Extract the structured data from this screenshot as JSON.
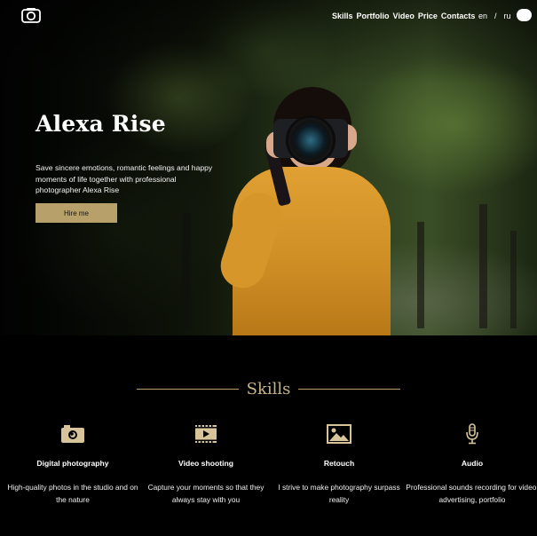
{
  "header": {
    "logo_icon": "camera-icon",
    "nav": [
      "Skills",
      "Portfolio",
      "Video",
      "Price",
      "Contacts"
    ],
    "lang": [
      "en",
      "/",
      "ru"
    ],
    "theme_toggle": "toggle"
  },
  "hero": {
    "title": "Alexa Rise",
    "description": "Save sincere emotions, romantic feelings and happy moments of life together with professional photographer Alexa Rise",
    "button": "Hire me"
  },
  "skills": {
    "title": "Skills",
    "items": [
      {
        "icon": "camera-icon",
        "name": "Digital photography",
        "text": "High-quality photos in the studio and on the nature"
      },
      {
        "icon": "film-icon",
        "name": "Video shooting",
        "text": "Capture your moments so that they always stay with you"
      },
      {
        "icon": "image-icon",
        "name": "Retouch",
        "text": "I strive to make photography surpass reality"
      },
      {
        "icon": "microphone-icon",
        "name": "Audio",
        "text": "Professional sounds recording for video, advertising, portfolio"
      }
    ]
  },
  "colors": {
    "accent": "#b8a06a",
    "background": "#000000"
  }
}
